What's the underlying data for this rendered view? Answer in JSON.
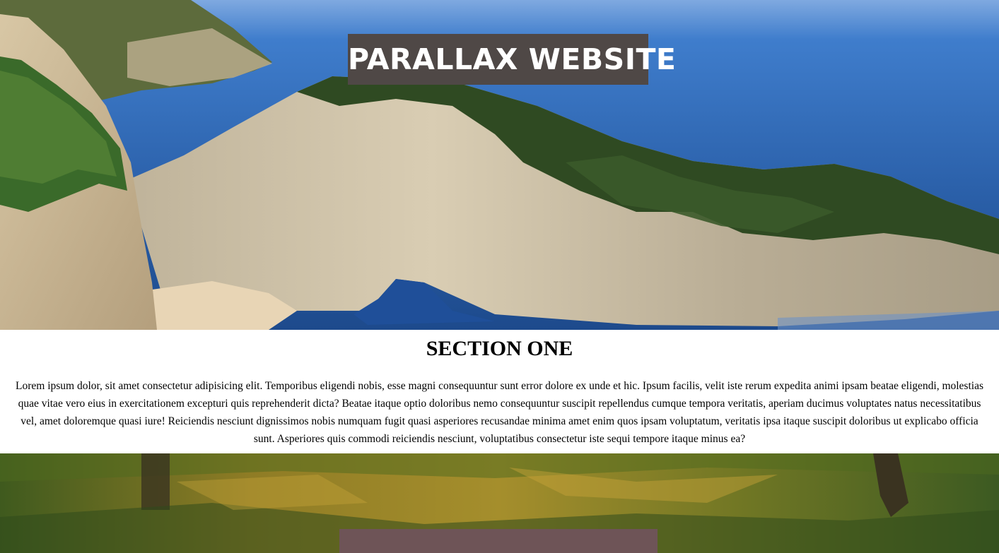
{
  "hero": {
    "title": "PARALLAX WEBSITE"
  },
  "section_one": {
    "heading": "SECTION ONE",
    "body": "Lorem ipsum dolor, sit amet consectetur adipisicing elit. Temporibus eligendi nobis, esse magni consequuntur sunt error dolore ex unde et hic. Ipsum facilis, velit iste rerum expedita animi ipsam beatae eligendi, molestias quae vitae vero eius in exercitationem excepturi quis reprehenderit dicta? Beatae itaque optio doloribus nemo consequuntur suscipit repellendus cumque tempora veritatis, aperiam ducimus voluptates natus necessitatibus vel, amet doloremque quasi iure! Reiciendis nesciunt dignissimos nobis numquam fugit quasi asperiores recusandae minima amet enim quos ipsam voluptatum, veritatis ipsa itaque suscipit doloribus ut explicabo officia sunt. Asperiores quis commodi reiciendis nesciunt, voluptatibus consectetur iste sequi tempore itaque minus ea?"
  },
  "colors": {
    "title_box": "#4f4846",
    "second_box": "#6e5457",
    "sea": "#2f68b0",
    "cliff": "#cfc2a8",
    "forest": "#2f4a22",
    "grass": "#8a7d2a"
  }
}
